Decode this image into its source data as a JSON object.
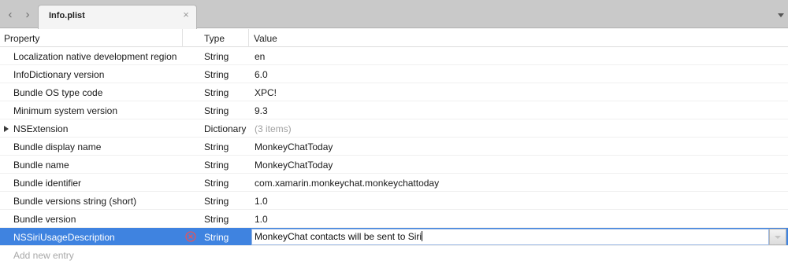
{
  "tabbar": {
    "tab_title": "Info.plist",
    "back_icon": "chevron-left-icon",
    "forward_icon": "chevron-right-icon",
    "close_icon": "close-icon",
    "menu_icon": "chevron-down-icon"
  },
  "columns": {
    "key": "Property",
    "type": "Type",
    "value": "Value"
  },
  "rows": [
    {
      "key": "Localization native development region",
      "type": "String",
      "value": "en"
    },
    {
      "key": "InfoDictionary version",
      "type": "String",
      "value": "6.0"
    },
    {
      "key": "Bundle OS type code",
      "type": "String",
      "value": "XPC!"
    },
    {
      "key": "Minimum system version",
      "type": "String",
      "value": "9.3"
    },
    {
      "key": "NSExtension",
      "type": "Dictionary",
      "value": "(3 items)"
    },
    {
      "key": "Bundle display name",
      "type": "String",
      "value": "MonkeyChatToday"
    },
    {
      "key": "Bundle name",
      "type": "String",
      "value": "MonkeyChatToday"
    },
    {
      "key": "Bundle identifier",
      "type": "String",
      "value": "com.xamarin.monkeychat.monkeychattoday"
    },
    {
      "key": "Bundle versions string (short)",
      "type": "String",
      "value": "1.0"
    },
    {
      "key": "Bundle version",
      "type": "String",
      "value": "1.0"
    },
    {
      "key": "NSSiriUsageDescription",
      "type": "String",
      "value": "MonkeyChat contacts will be sent to Siri"
    }
  ],
  "add_entry": "Add new entry",
  "colors": {
    "selection": "#3f83e0",
    "tabbar_bg": "#c9c9c9",
    "error_icon": "#e0555f"
  }
}
